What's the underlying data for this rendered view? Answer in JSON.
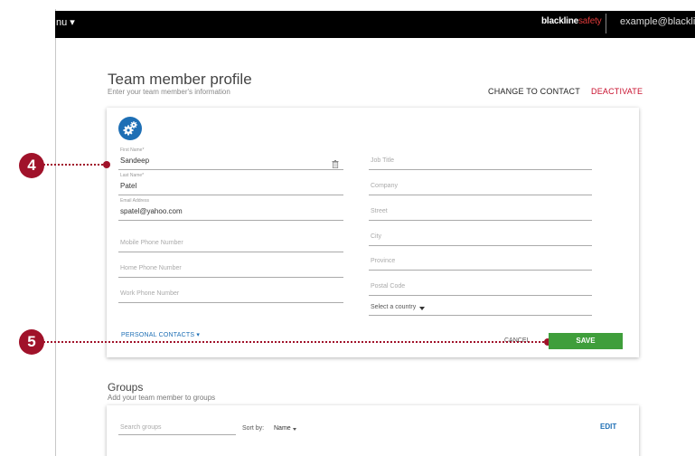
{
  "topbar": {
    "menu_label": "nu ▾",
    "brand_part1": "blackline",
    "brand_part2": "safety",
    "user_email": "example@blacklinesafety.com"
  },
  "header": {
    "title": "Team member profile",
    "subtitle": "Enter your team member's information",
    "change_to_contact": "CHANGE TO CONTACT",
    "deactivate": "DEACTIVATE"
  },
  "form": {
    "first_name": {
      "label": "First Name*",
      "value": "Sandeep"
    },
    "last_name": {
      "label": "Last Name*",
      "value": "Patel"
    },
    "email": {
      "label": "Email Address",
      "value": "spatel@yahoo.com"
    },
    "mobile_phone": {
      "placeholder": "Mobile Phone Number"
    },
    "home_phone": {
      "placeholder": "Home Phone Number"
    },
    "work_phone": {
      "placeholder": "Work Phone Number"
    },
    "job_title": {
      "placeholder": "Job Title"
    },
    "company": {
      "placeholder": "Company"
    },
    "street": {
      "placeholder": "Street"
    },
    "city": {
      "placeholder": "City"
    },
    "province": {
      "placeholder": "Province"
    },
    "postal_code": {
      "placeholder": "Postal Code"
    },
    "country": {
      "selected": "Select a country"
    },
    "personal_contacts": "PERSONAL CONTACTS ▾",
    "cancel": "CANCEL",
    "save": "SAVE"
  },
  "annotations": {
    "step_4": "4",
    "step_5": "5"
  },
  "groups": {
    "title": "Groups",
    "subtitle": "Add your team member to groups",
    "search_placeholder": "Search groups",
    "sort_by_label": "Sort by:",
    "sort_by_value": "Name",
    "edit": "EDIT"
  },
  "colors": {
    "accent_blue": "#1e6fb5",
    "save_green": "#3f9e3b",
    "brand_red": "#c8102e",
    "annotation_red": "#a0122a"
  }
}
